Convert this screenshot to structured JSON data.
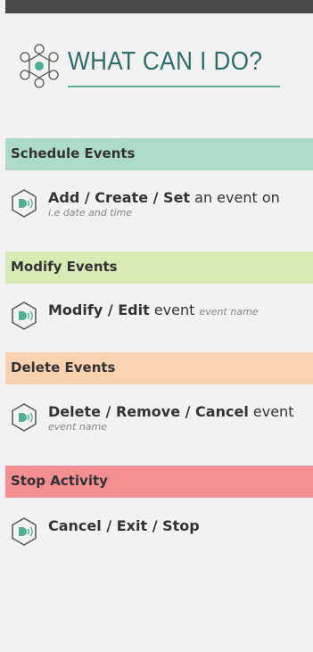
{
  "header": {
    "title": "WHAT CAN I DO?"
  },
  "colors": {
    "schedule": "#acdcc7",
    "modify": "#d9ebb4",
    "delete": "#fcd1b0",
    "stop": "#f38e91",
    "accent": "#5aaf98"
  },
  "sections": [
    {
      "title": "Schedule Events",
      "command": {
        "bold": "Add / Create / Set",
        "plain": " an event on",
        "hint": "i.e date and time"
      }
    },
    {
      "title": "Modify Events",
      "command": {
        "bold": "Modify / Edit",
        "plain": " event ",
        "hint": "event name"
      }
    },
    {
      "title": "Delete Events",
      "command": {
        "bold": "Delete / Remove / Cancel",
        "plain": " event",
        "hint": "event name"
      }
    },
    {
      "title": "Stop Activity",
      "command": {
        "bold": "Cancel / Exit / Stop",
        "plain": "",
        "hint": ""
      }
    }
  ]
}
